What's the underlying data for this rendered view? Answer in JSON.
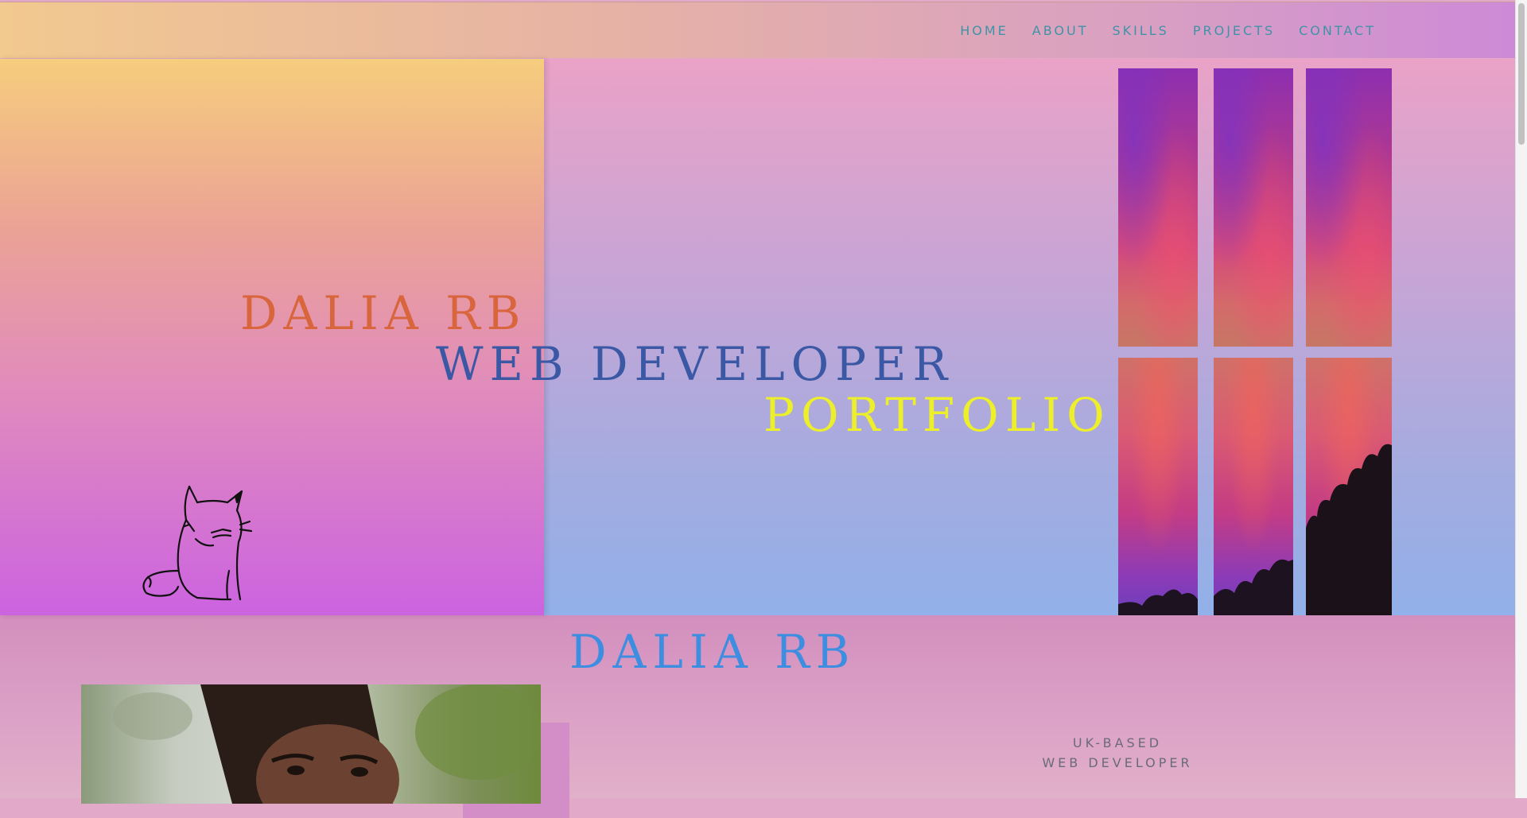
{
  "nav": {
    "items": [
      {
        "label": "HOME"
      },
      {
        "label": "ABOUT"
      },
      {
        "label": "SKILLS"
      },
      {
        "label": "PROJECTS"
      },
      {
        "label": "CONTACT"
      }
    ]
  },
  "hero": {
    "name": "DALIA RB",
    "role": "WEB DEVELOPER",
    "subtitle": "PORTFOLIO"
  },
  "about": {
    "title": "DALIA RB",
    "tagline_line1": "UK-BASED",
    "tagline_line2": "WEB DEVELOPER"
  },
  "colors": {
    "nav_text": "#3f93a7",
    "name": "#d8653c",
    "role": "#3b58a5",
    "subtitle": "#ecef2a",
    "about_title": "#3d8ee0"
  }
}
